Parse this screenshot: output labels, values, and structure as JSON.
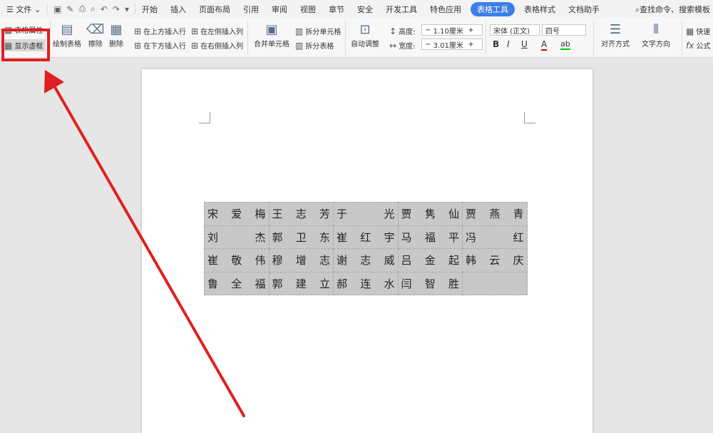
{
  "menubar": {
    "menu_label": "文件",
    "qat_icons": [
      "save-icon",
      "format-painter-icon",
      "print-icon",
      "print-preview-icon",
      "undo-icon",
      "redo-icon",
      "dropdown-icon"
    ],
    "tabs": [
      "开始",
      "插入",
      "页面布局",
      "引用",
      "审阅",
      "视图",
      "章节",
      "安全",
      "开发工具",
      "特色应用",
      "表格工具",
      "表格样式",
      "文档助手"
    ],
    "active_tab": "表格工具",
    "search": "查找命令、搜索模板"
  },
  "ribbon": {
    "table_props": "表格属性",
    "show_grid": "显示虚框",
    "draw_table": "绘制表格",
    "erase": "擦除",
    "delete": "删除",
    "insert_above": "在上方插入行",
    "insert_below": "在下方插入行",
    "insert_left": "在左侧插入列",
    "insert_right": "在右侧插入列",
    "merge": "合并单元格",
    "split_cell": "拆分单元格",
    "split_table": "拆分表格",
    "auto_fit": "自动调整",
    "height_label": "高度:",
    "height_value": "1.10厘米",
    "width_label": "宽度:",
    "width_value": "3.01厘米",
    "minus": "−",
    "plus": "+",
    "font_name": "宋体 (正文)",
    "font_size": "四号",
    "bold": "B",
    "italic": "I",
    "underline": "U",
    "font_color": "A",
    "highlight": "ab",
    "align": "对齐方式",
    "text_dir": "文字方向",
    "quick_calc": "快速",
    "formula": "公式"
  },
  "table": {
    "rows": [
      [
        [
          "宋",
          "爱",
          "梅"
        ],
        [
          "王",
          "志",
          "芳"
        ],
        [
          "于",
          "",
          "光"
        ],
        [
          "贾",
          "隽",
          "仙"
        ],
        [
          "贾",
          "燕",
          "青"
        ]
      ],
      [
        [
          "刘",
          "",
          "杰"
        ],
        [
          "郭",
          "卫",
          "东"
        ],
        [
          "崔",
          "红",
          "宇"
        ],
        [
          "马",
          "福",
          "平"
        ],
        [
          "冯",
          "",
          "红"
        ]
      ],
      [
        [
          "崔",
          "敬",
          "伟"
        ],
        [
          "穆",
          "增",
          "志"
        ],
        [
          "谢",
          "志",
          "威"
        ],
        [
          "吕",
          "金",
          "起"
        ],
        [
          "韩",
          "云",
          "庆"
        ]
      ],
      [
        [
          "鲁",
          "全",
          "福"
        ],
        [
          "郭",
          "建",
          "立"
        ],
        [
          "郝",
          "连",
          "水"
        ],
        [
          "闫",
          "智",
          "胜"
        ],
        [
          "",
          "",
          ""
        ]
      ]
    ]
  },
  "colors": {
    "accent": "#3c7ee8",
    "highlight_box": "#e02020",
    "table_fill": "#c8c8c8"
  }
}
